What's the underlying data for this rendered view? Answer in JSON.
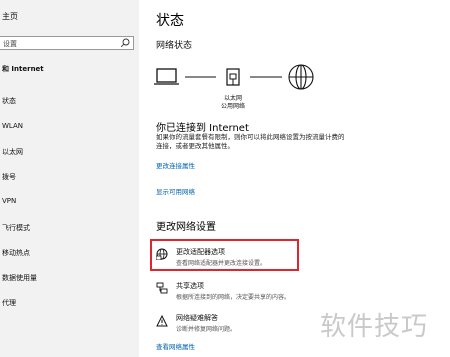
{
  "sidebar": {
    "home_label": "主页",
    "search_placeholder": "设置",
    "section_title": "和 Internet",
    "items": [
      {
        "label": "状态"
      },
      {
        "label": "WLAN"
      },
      {
        "label": "以太网"
      },
      {
        "label": "拨号"
      },
      {
        "label": "VPN"
      },
      {
        "label": "飞行模式"
      },
      {
        "label": "移动热点"
      },
      {
        "label": "数据使用量"
      },
      {
        "label": "代理"
      }
    ]
  },
  "main": {
    "title": "状态",
    "network_status_heading": "网络状态",
    "diagram": {
      "adapter_label": "以太网",
      "network_label": "公用网络"
    },
    "connected_title": "你已连接到 Internet",
    "connected_desc_line1": "如果你的流量套餐有限制，则你可以将此网络设置为按流量计费的",
    "connected_desc_line2": "连接，或者更改其他属性。",
    "link_change_props": "更改连接属性",
    "link_show_networks": "显示可用网络",
    "change_settings_heading": "更改网络设置",
    "options": [
      {
        "title": "更改适配器选项",
        "desc": "查看网络适配器并更改连接设置。",
        "icon": "adapter-icon"
      },
      {
        "title": "共享选项",
        "desc": "根据所连接到的网络，决定要共享的内容。",
        "icon": "sharing-icon"
      },
      {
        "title": "网络疑难解答",
        "desc": "诊断并修复网络问题。",
        "icon": "warning-icon"
      }
    ],
    "link_view_props": "查看网络属性"
  },
  "watermark": "软件技巧",
  "colors": {
    "link": "#0063b1",
    "highlight": "#e0262c",
    "sidebar_bg": "#f2f2f2"
  }
}
